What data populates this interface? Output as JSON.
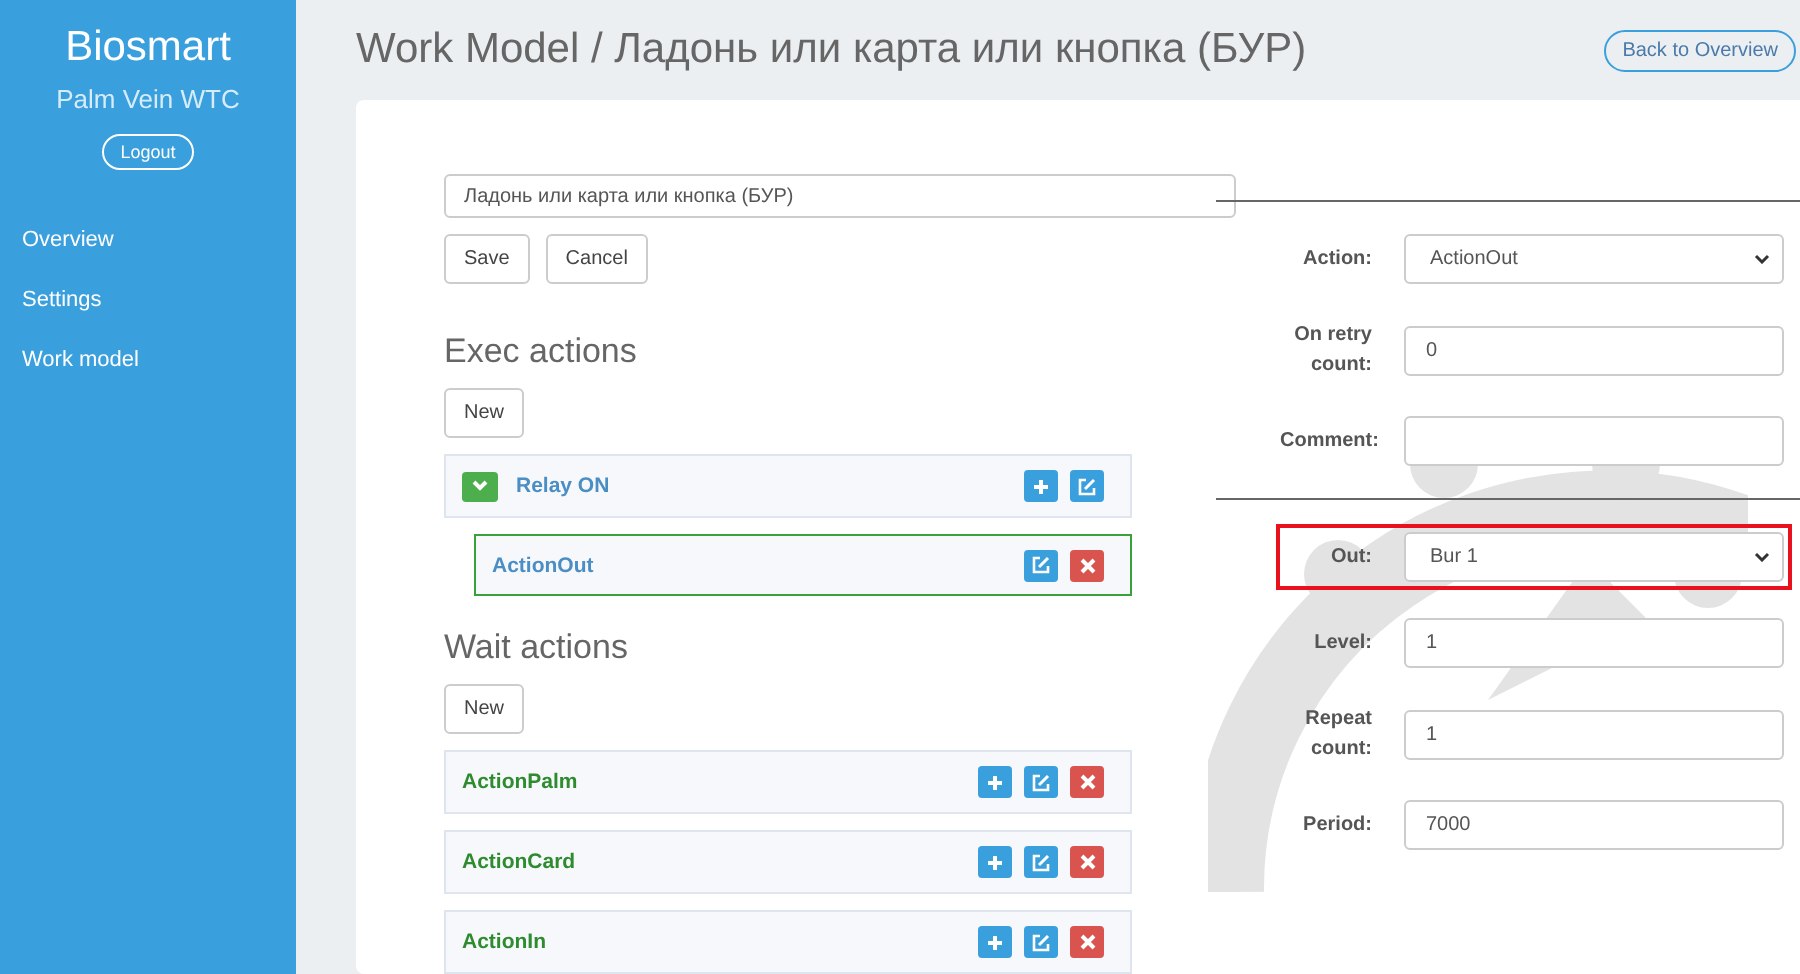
{
  "sidebar": {
    "brand": "Biosmart",
    "subtitle": "Palm Vein WTC",
    "logout": "Logout",
    "items": [
      {
        "label": "Overview"
      },
      {
        "label": "Settings"
      },
      {
        "label": "Work model"
      }
    ]
  },
  "header": {
    "title": "Work Model / Ладонь или карта или кнопка (БУР)",
    "back_button": "Back to Overview"
  },
  "editor": {
    "name_value": "Ладонь или карта или кнопка (БУР)",
    "save": "Save",
    "cancel": "Cancel"
  },
  "sections": [
    {
      "heading": "Exec actions",
      "new_button": "New",
      "items": [
        {
          "label": "Relay ON",
          "color": "#4a8ec4",
          "expanded": true,
          "selected": false,
          "buttons": [
            {
              "kind": "add"
            },
            {
              "kind": "edit"
            }
          ],
          "children": [
            {
              "label": "ActionOut",
              "color": "#4a8ec4",
              "selected": true,
              "buttons": [
                {
                  "kind": "edit"
                },
                {
                  "kind": "delete"
                }
              ]
            }
          ]
        }
      ]
    },
    {
      "heading": "Wait actions",
      "new_button": "New",
      "items": [
        {
          "label": "ActionPalm",
          "color": "#2e8b2e",
          "selected": false,
          "buttons": [
            {
              "kind": "add"
            },
            {
              "kind": "edit"
            },
            {
              "kind": "delete"
            }
          ]
        },
        {
          "label": "ActionCard",
          "color": "#2e8b2e",
          "selected": false,
          "buttons": [
            {
              "kind": "add"
            },
            {
              "kind": "edit"
            },
            {
              "kind": "delete"
            }
          ]
        },
        {
          "label": "ActionIn",
          "color": "#2e8b2e",
          "selected": false,
          "buttons": [
            {
              "kind": "add"
            },
            {
              "kind": "edit"
            },
            {
              "kind": "delete"
            }
          ]
        }
      ]
    }
  ],
  "form": {
    "groups": [
      {
        "fields": [
          {
            "kind": "select",
            "label": "Action:",
            "value": "ActionOut",
            "highlighted": false
          },
          {
            "kind": "input",
            "label": "On retry count:",
            "value": "0",
            "highlighted": false
          },
          {
            "kind": "input",
            "label": "Comment:",
            "highlighted": false
          }
        ]
      },
      {
        "fields": [
          {
            "kind": "select",
            "label": "Out:",
            "value": "Bur 1",
            "highlighted": true
          },
          {
            "kind": "input",
            "label": "Level:",
            "value": "1",
            "highlighted": false
          },
          {
            "kind": "input",
            "label": "Repeat count:",
            "value": "1",
            "highlighted": false
          },
          {
            "kind": "input",
            "label": "Period:",
            "value": "7000",
            "highlighted": false
          }
        ]
      }
    ]
  }
}
